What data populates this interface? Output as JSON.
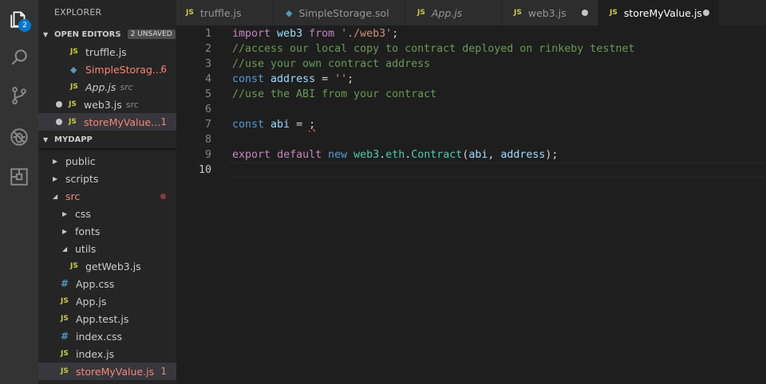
{
  "activity": {
    "badge": "2",
    "icons": [
      "explorer-icon",
      "search-icon",
      "source-control-icon",
      "debug-icon",
      "extensions-icon"
    ]
  },
  "sidebar": {
    "title": "EXPLORER",
    "open_editors": {
      "label": "OPEN EDITORS",
      "unsaved": "2 UNSAVED",
      "items": [
        {
          "icon": "JS",
          "name": "truffle.js",
          "desc": "",
          "count": ""
        },
        {
          "icon": "◆",
          "name": "SimpleStorag...",
          "desc": "",
          "count": "6"
        },
        {
          "icon": "JS",
          "name": "App.js",
          "desc": "src",
          "count": ""
        },
        {
          "icon": "JS",
          "name": "web3.js",
          "desc": "src",
          "count": ""
        },
        {
          "icon": "JS",
          "name": "storeMyValue...",
          "desc": "",
          "count": "1"
        }
      ]
    },
    "project": {
      "label": "MYDAPP",
      "items": [
        {
          "name": "public"
        },
        {
          "name": "scripts"
        },
        {
          "name": "src"
        },
        {
          "name": "css"
        },
        {
          "name": "fonts"
        },
        {
          "name": "utils"
        },
        {
          "icon": "JS",
          "name": "getWeb3.js"
        },
        {
          "icon": "#",
          "name": "App.css"
        },
        {
          "icon": "JS",
          "name": "App.js"
        },
        {
          "icon": "JS",
          "name": "App.test.js"
        },
        {
          "icon": "#",
          "name": "index.css"
        },
        {
          "icon": "JS",
          "name": "index.js"
        },
        {
          "icon": "JS",
          "name": "storeMyValue.js",
          "count": "1"
        }
      ]
    }
  },
  "tabs": [
    {
      "icon": "JS",
      "label": "truffle.js"
    },
    {
      "icon": "◆",
      "label": "SimpleStorage.sol"
    },
    {
      "icon": "JS",
      "label": "App.js"
    },
    {
      "icon": "JS",
      "label": "web3.js"
    },
    {
      "icon": "JS",
      "label": "storeMyValue.js"
    }
  ],
  "editor": {
    "line_numbers": [
      "1",
      "2",
      "3",
      "4",
      "5",
      "6",
      "7",
      "8",
      "9",
      "10"
    ],
    "lines": {
      "l1": {
        "a": "import",
        "b": " web3 ",
        "c": "from",
        "d": " ",
        "e": "'./web3'",
        "f": ";"
      },
      "l2": "//access our local copy to contract deployed on rinkeby testnet",
      "l3": "//use your own contract address",
      "l4": {
        "a": "const",
        "b": " ",
        "c": "address",
        "d": " = ",
        "e": "''",
        "f": ";"
      },
      "l6": "//use the ABI from your contract",
      "l7": {
        "a": "const",
        "b": " ",
        "c": "abi",
        "d": " = ",
        "e": ";"
      },
      "l9": {
        "a": "export",
        "b": " ",
        "c": "default",
        "d": " ",
        "e": "new",
        "f": " ",
        "g": "web3",
        "h": ".",
        "i": "eth",
        "j": ".",
        "k": "Contract",
        "l": "(",
        "m": "abi",
        "n": ", ",
        "o": "address",
        "p": ");"
      }
    }
  },
  "colors": {
    "accent": "#007acc",
    "error": "#f48771",
    "js_icon": "#cbcb41"
  }
}
